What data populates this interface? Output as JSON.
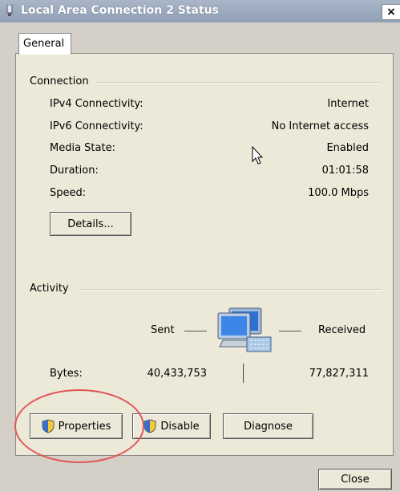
{
  "window": {
    "title": "Local Area Connection 2 Status",
    "close_glyph": "×"
  },
  "tabs": [
    {
      "label": "General"
    }
  ],
  "connection": {
    "group_label": "Connection",
    "rows": [
      {
        "label": "IPv4 Connectivity:",
        "value": "Internet"
      },
      {
        "label": "IPv6 Connectivity:",
        "value": "No Internet access"
      },
      {
        "label": "Media State:",
        "value": "Enabled"
      },
      {
        "label": "Duration:",
        "value": "01:01:58"
      },
      {
        "label": "Speed:",
        "value": "100.0 Mbps"
      }
    ],
    "details_button": "Details..."
  },
  "activity": {
    "group_label": "Activity",
    "sent_label": "Sent",
    "received_label": "Received",
    "bytes_label": "Bytes:",
    "bytes_sent": "40,433,753",
    "bytes_received": "77,827,311"
  },
  "buttons": {
    "properties": "Properties",
    "disable": "Disable",
    "diagnose": "Diagnose",
    "close": "Close"
  },
  "colors": {
    "title_bar": "#9aa8bd",
    "panel": "#ece9d8",
    "annotation_circle": "#e05555"
  }
}
